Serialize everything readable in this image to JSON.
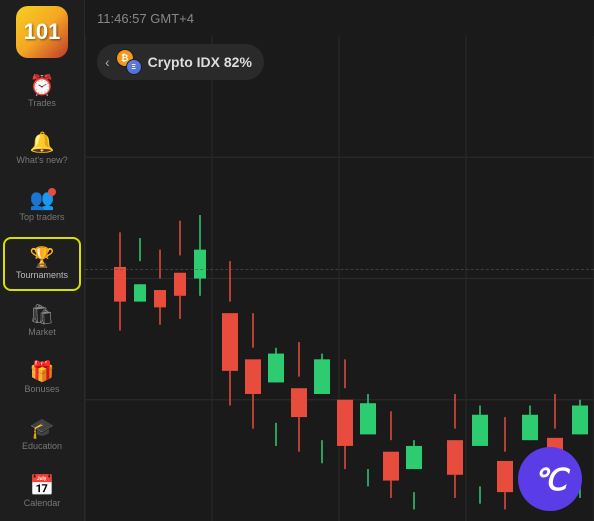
{
  "topbar": {
    "time": "11:46:57 GMT+4"
  },
  "asset": {
    "name": "Crypto IDX 82%",
    "icon1": "₿",
    "icon2": "Ξ"
  },
  "sidebar": {
    "logo": "101",
    "items": [
      {
        "id": "trades",
        "label": "Trades",
        "icon": "⏰",
        "active": false,
        "badge": false
      },
      {
        "id": "whats-new",
        "label": "What's new?",
        "icon": "🔔",
        "active": false,
        "badge": false
      },
      {
        "id": "top-traders",
        "label": "Top traders",
        "icon": "👥",
        "active": false,
        "badge": true
      },
      {
        "id": "tournaments",
        "label": "Tournaments",
        "icon": "🏆",
        "active": true,
        "badge": false
      },
      {
        "id": "market",
        "label": "Market",
        "icon": "🛍",
        "active": false,
        "badge": false
      },
      {
        "id": "bonuses",
        "label": "Bonuses",
        "icon": "🎁",
        "active": false,
        "badge": false
      },
      {
        "id": "education",
        "label": "Education",
        "icon": "🎓",
        "active": false,
        "badge": false
      },
      {
        "id": "calendar",
        "label": "Calendar",
        "icon": "📅",
        "active": false,
        "badge": false
      }
    ]
  },
  "watermark": {
    "symbol": "℃"
  }
}
